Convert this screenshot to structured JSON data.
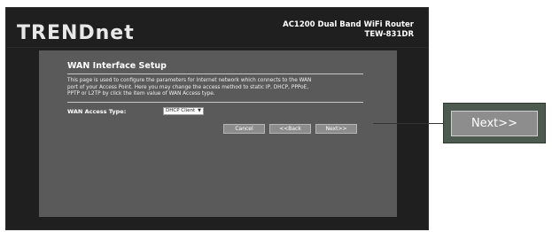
{
  "brand": {
    "logo": "TRENDnet"
  },
  "product": {
    "name": "AC1200 Dual Band WiFi Router",
    "model": "TEW-831DR"
  },
  "section": {
    "title": "WAN Interface Setup",
    "description": "This page is used to configure the parameters for Internet network which connects to the WAN\nport of your Access Point. Here you may change the access method to static IP, DHCP, PPPoE,\nPPTP or L2TP by click the item value of WAN Access type."
  },
  "wan_access": {
    "label": "WAN Access Type:",
    "selected": "DHCP Client",
    "arrow_icon": "chevron-down-icon"
  },
  "buttons": {
    "cancel": "Cancel",
    "back": "<<Back",
    "next": "Next>>"
  },
  "callout": {
    "label": "Next>>"
  }
}
